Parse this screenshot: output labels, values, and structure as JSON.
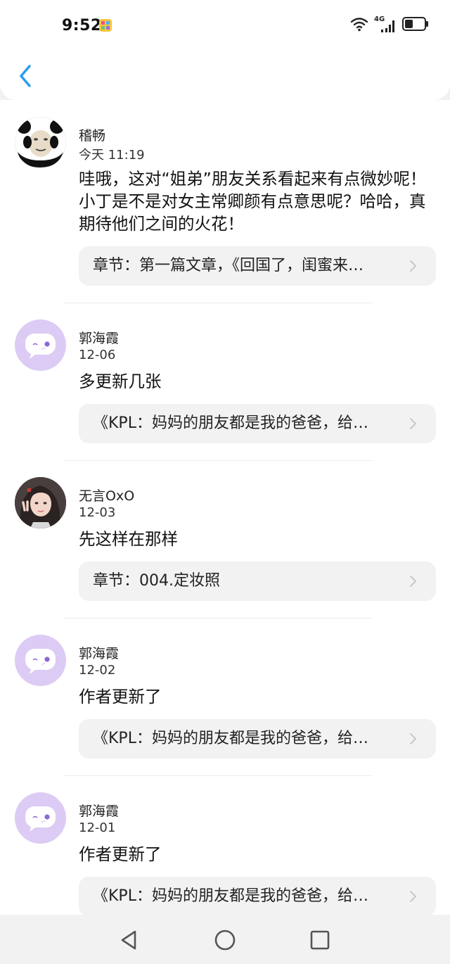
{
  "status_bar": {
    "time": "9:52",
    "network": "4G"
  },
  "colors": {
    "accent": "#2b9cf0",
    "avatar_purple": "#dccbf4",
    "card_bg": "#f2f2f2"
  },
  "comments": [
    {
      "username": "稽畅",
      "date": "今天 11:19",
      "text": "哇哦，这对“姐弟”朋友关系看起来有点微妙呢！小丁是不是对女主常卿颜有点意思呢？哈哈，真期待他们之间的火花！",
      "ref": "章节：第一篇文章，《回国了，闺蜜来…",
      "avatar": "panda-meme-avatar"
    },
    {
      "username": "郭海霞",
      "date": "12-06",
      "text": "多更新几张",
      "ref": "《KPL：妈妈的朋友都是我的爸爸，给…",
      "avatar": "default-chat-avatar"
    },
    {
      "username": "无言OxO",
      "date": "12-03",
      "text": "先这样在那样",
      "ref": "章节：004.定妆照",
      "avatar": "girl-photo-avatar"
    },
    {
      "username": "郭海霞",
      "date": "12-02",
      "text": "作者更新了",
      "ref": "《KPL：妈妈的朋友都是我的爸爸，给…",
      "avatar": "default-chat-avatar"
    },
    {
      "username": "郭海霞",
      "date": "12-01",
      "text": "作者更新了",
      "ref": "《KPL：妈妈的朋友都是我的爸爸，给…",
      "avatar": "default-chat-avatar"
    }
  ]
}
